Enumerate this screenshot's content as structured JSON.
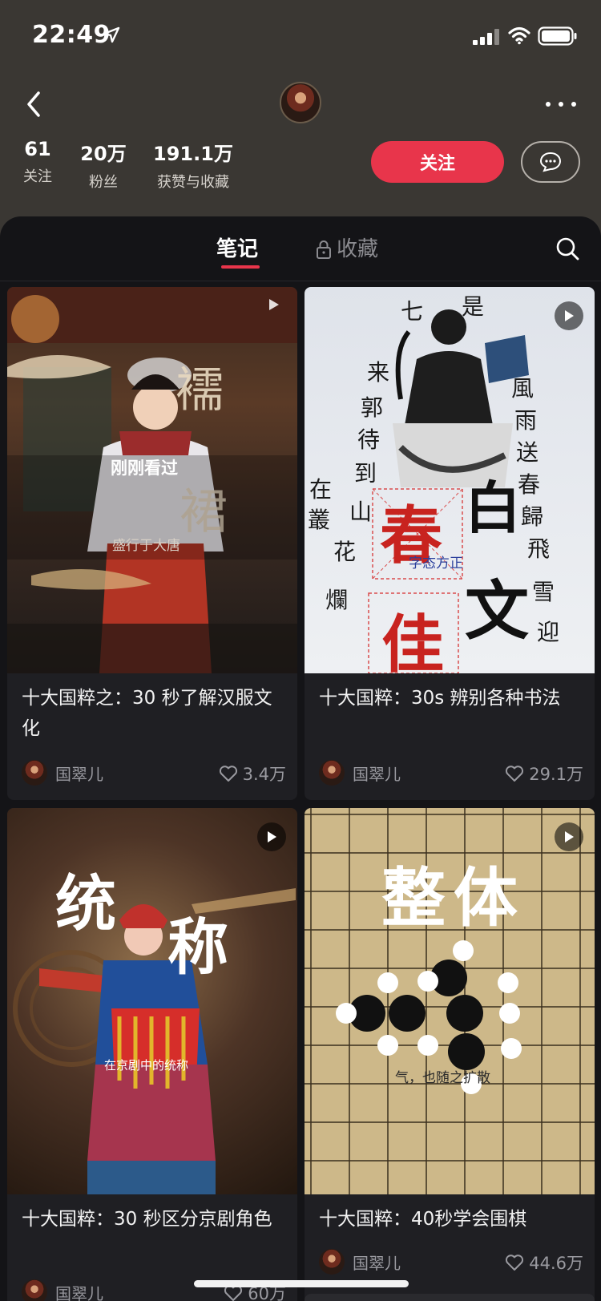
{
  "status_bar": {
    "time": "22:49"
  },
  "profile": {
    "stats": [
      {
        "value": "61",
        "label": "关注"
      },
      {
        "value": "20万",
        "label": "粉丝"
      },
      {
        "value": "191.1万",
        "label": "获赞与收藏"
      }
    ],
    "follow_label": "关注"
  },
  "tabs": {
    "notes": "笔记",
    "collections": "收藏"
  },
  "cards": [
    {
      "title": "十大国粹之：30 秒了解汉服文化",
      "author": "国翠儿",
      "likes": "3.4万",
      "overlay_main": "刚刚看过",
      "overlay_caption": "盛行于大唐",
      "art_chars": [
        "襦",
        "裙"
      ]
    },
    {
      "title": "十大国粹：30s 辨别各种书法",
      "author": "国翠儿",
      "likes": "29.1万",
      "overlay_caption": "字态方正",
      "art_chars": [
        "春",
        "白",
        "文",
        "佳"
      ]
    },
    {
      "title": "十大国粹：30 秒区分京剧角色",
      "author": "国翠儿",
      "likes": "60万",
      "overlay_caption": "在京剧中的统称",
      "art_chars": [
        "统",
        "称"
      ]
    },
    {
      "title": "十大国粹：40秒学会围棋",
      "author": "国翠儿",
      "likes": "44.6万",
      "overlay_caption": "气，也随之扩散",
      "art_chars": [
        "整",
        "体"
      ]
    }
  ],
  "colors": {
    "accent": "#e8354b",
    "header_bg": "#3a3733",
    "panel_bg": "#141417",
    "card_bg": "#1f1f23"
  }
}
